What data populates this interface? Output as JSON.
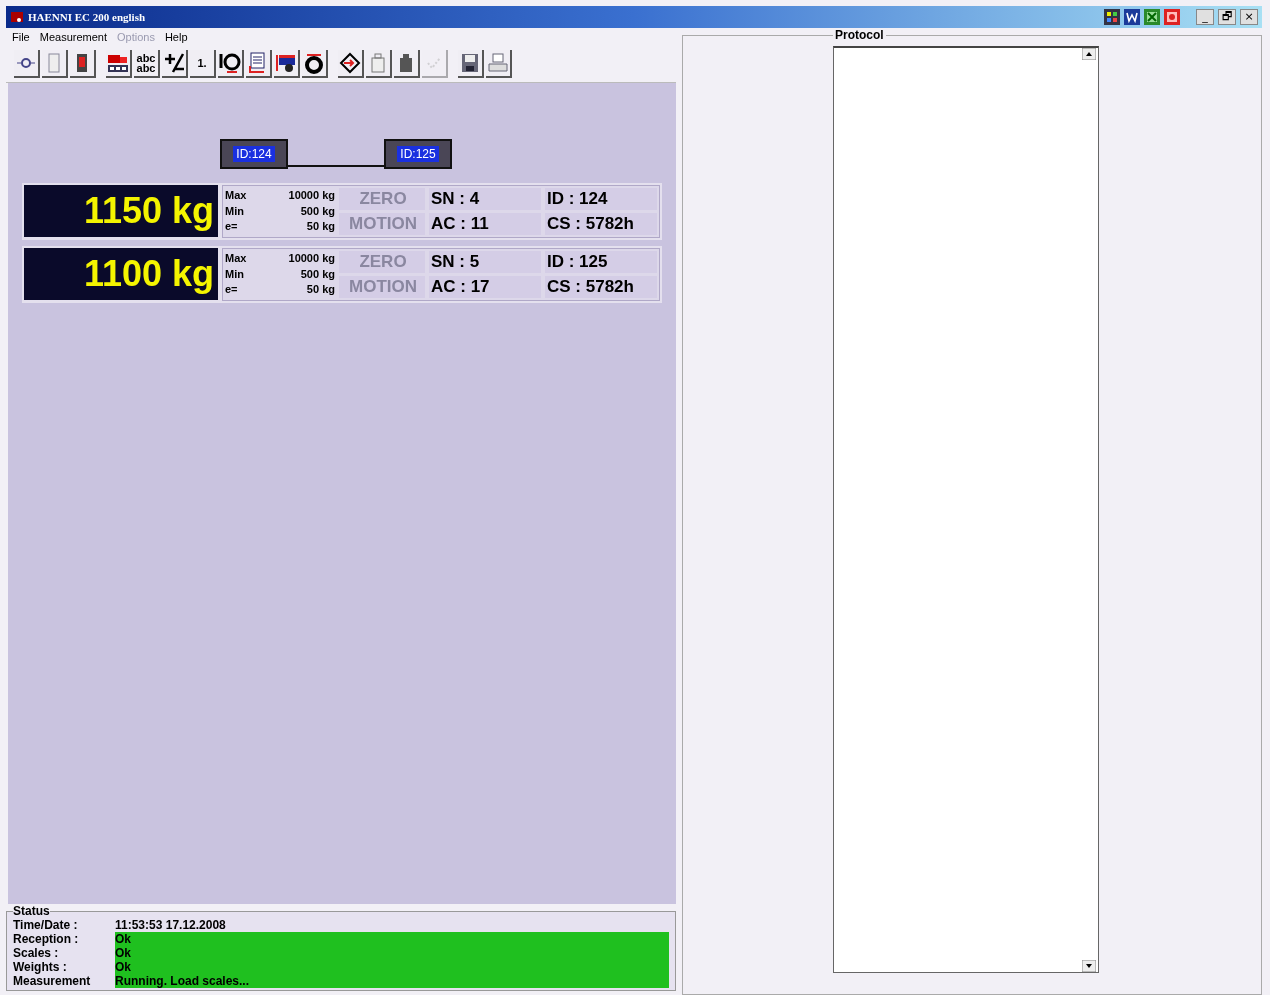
{
  "window": {
    "title": "HAENNI EC 200 english"
  },
  "menu": [
    {
      "label": "File",
      "disabled": false
    },
    {
      "label": "Measurement",
      "disabled": false
    },
    {
      "label": "Options",
      "disabled": true
    },
    {
      "label": "Help",
      "disabled": false
    }
  ],
  "toolbar": [
    [
      {
        "kind": "zero",
        "disabled": false
      },
      {
        "kind": "blank-scale",
        "disabled": false
      },
      {
        "kind": "indicator",
        "disabled": false
      }
    ],
    [
      {
        "kind": "truck",
        "disabled": false
      },
      {
        "kind": "text",
        "label": "abc abc",
        "disabled": false
      },
      {
        "kind": "plusminus",
        "disabled": false
      },
      {
        "kind": "text",
        "label": "1.",
        "disabled": false
      },
      {
        "kind": "wheel",
        "disabled": false
      },
      {
        "kind": "list",
        "disabled": false
      },
      {
        "kind": "trailer",
        "disabled": false
      },
      {
        "kind": "tire",
        "disabled": false
      }
    ],
    [
      {
        "kind": "enter",
        "disabled": false
      },
      {
        "kind": "weight",
        "disabled": false
      },
      {
        "kind": "weight-dark",
        "disabled": false
      },
      {
        "kind": "check",
        "disabled": true
      }
    ],
    [
      {
        "kind": "save",
        "disabled": false
      },
      {
        "kind": "print",
        "disabled": false
      }
    ]
  ],
  "title_buttons": [
    "_",
    "🗗",
    "×"
  ],
  "nodes": [
    {
      "label": "ID:124"
    },
    {
      "label": "ID:125"
    }
  ],
  "scales": [
    {
      "weight": "1150 kg",
      "max_label": "Max",
      "max": "10000 kg",
      "min_label": "Min",
      "min": "500 kg",
      "e_label": "e=",
      "e": "50 kg",
      "zero": "ZERO",
      "zero_active": false,
      "motion": "MOTION",
      "motion_active": false,
      "sn": "SN : 4",
      "ac": "AC : 11",
      "id": "ID : 124",
      "cs": "CS : 5782h"
    },
    {
      "weight": "1100 kg",
      "max_label": "Max",
      "max": "10000 kg",
      "min_label": "Min",
      "min": "500 kg",
      "e_label": "e=",
      "e": "50 kg",
      "zero": "ZERO",
      "zero_active": false,
      "motion": "MOTION",
      "motion_active": false,
      "sn": "SN : 5",
      "ac": "AC : 17",
      "id": "ID : 125",
      "cs": "CS : 5782h"
    }
  ],
  "status": {
    "title": "Status",
    "rows": [
      {
        "label": "Time/Date :",
        "value": "11:53:53   17.12.2008",
        "ok": false
      },
      {
        "label": "Reception :",
        "value": "Ok",
        "ok": true
      },
      {
        "label": "Scales :",
        "value": "Ok",
        "ok": true
      },
      {
        "label": "Weights :",
        "value": "Ok",
        "ok": true
      },
      {
        "label": "Measurement",
        "value": "Running. Load scales...",
        "ok": true
      }
    ]
  },
  "protocol": {
    "title": "Protocol"
  }
}
